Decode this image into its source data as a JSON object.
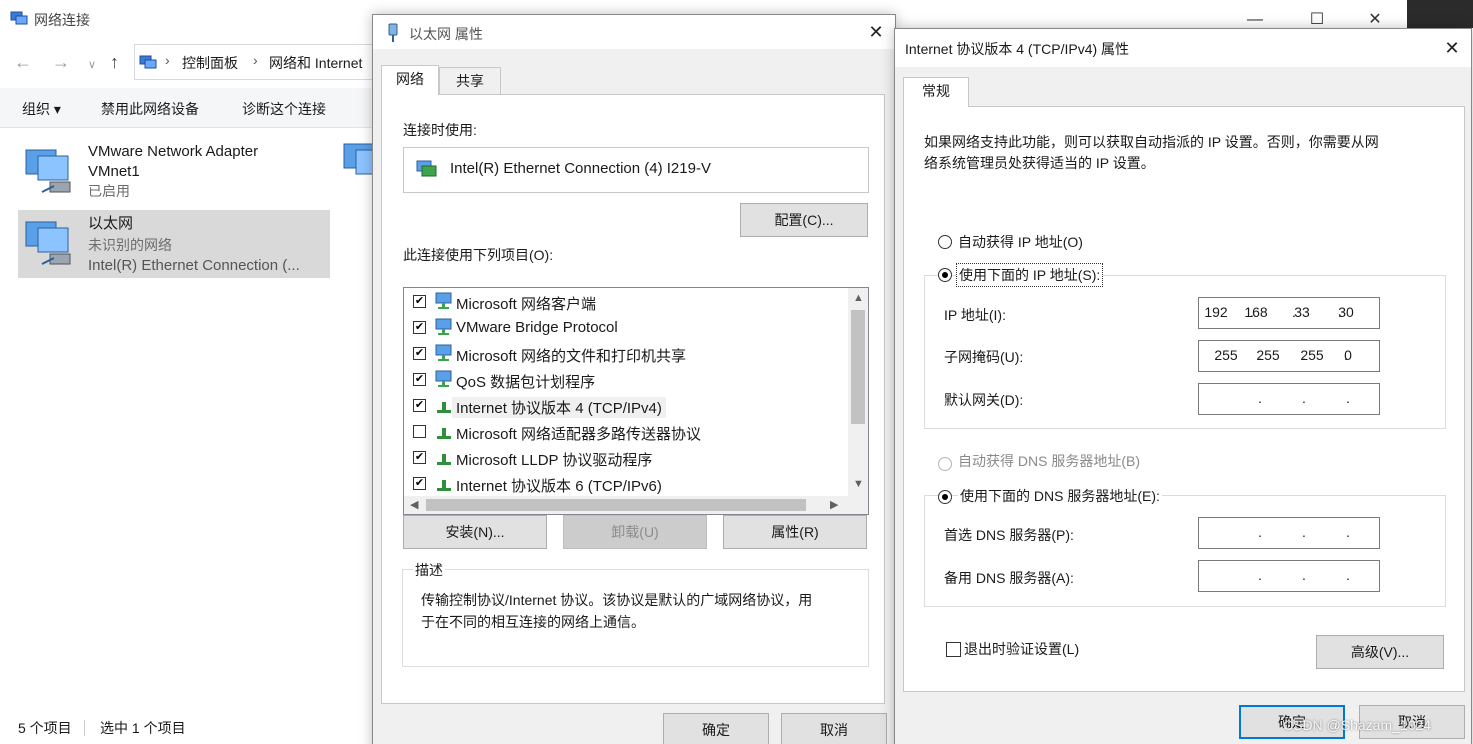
{
  "explorer": {
    "title": "网络连接",
    "breadcrumb": [
      "控制面板",
      "网络和 Internet"
    ],
    "commands": [
      "组织 ▾",
      "禁用此网络设备",
      "诊断这个连接"
    ],
    "connections": [
      {
        "name": "VMware Network Adapter",
        "name2": "VMnet1",
        "status": "已启用",
        "device": ""
      },
      {
        "name": "以太网",
        "name2": "",
        "status": "未识别的网络",
        "device": "Intel(R) Ethernet Connection (..."
      }
    ],
    "status": {
      "count": "5 个项目",
      "selected": "选中 1 个项目"
    }
  },
  "ethernet_dialog": {
    "title": "以太网 属性",
    "tabs": [
      "网络",
      "共享"
    ],
    "connect_using_label": "连接时使用:",
    "adapter": "Intel(R) Ethernet Connection (4) I219-V",
    "configure_label": "配置(C)...",
    "items_label": "此连接使用下列项目(O):",
    "items": [
      {
        "label": "Microsoft 网络客户端",
        "checked": true
      },
      {
        "label": "VMware Bridge Protocol",
        "checked": true
      },
      {
        "label": "Microsoft 网络的文件和打印机共享",
        "checked": true
      },
      {
        "label": "QoS 数据包计划程序",
        "checked": true
      },
      {
        "label": "Internet 协议版本 4 (TCP/IPv4)",
        "checked": true
      },
      {
        "label": "Microsoft 网络适配器多路传送器协议",
        "checked": false
      },
      {
        "label": "Microsoft LLDP 协议驱动程序",
        "checked": true
      },
      {
        "label": "Internet 协议版本 6 (TCP/IPv6)",
        "checked": true
      }
    ],
    "install_label": "安装(N)...",
    "uninstall_label": "卸载(U)",
    "properties_label": "属性(R)",
    "description_heading": "描述",
    "description_line1": "传输控制协议/Internet 协议。该协议是默认的广域网络协议，用",
    "description_line2": "于在不同的相互连接的网络上通信。",
    "ok_label": "确定",
    "cancel_label": "取消"
  },
  "ipv4_dialog": {
    "title": "Internet 协议版本 4 (TCP/IPv4) 属性",
    "tab": "常规",
    "intro_line1": "如果网络支持此功能，则可以获取自动指派的 IP 设置。否则，你需要从网",
    "intro_line2": "络系统管理员处获得适当的 IP 设置。",
    "auto_ip_label": "自动获得 IP 地址(O)",
    "manual_ip_label": "使用下面的 IP 地址(S):",
    "ip_label": "IP 地址(I):",
    "ip": [
      "192",
      "168",
      "33",
      "30"
    ],
    "mask_label": "子网掩码(U):",
    "mask": [
      "255",
      "255",
      "255",
      "0"
    ],
    "gateway_label": "默认网关(D):",
    "auto_dns_label": "自动获得 DNS 服务器地址(B)",
    "manual_dns_label": "使用下面的 DNS 服务器地址(E):",
    "preferred_dns_label": "首选 DNS 服务器(P):",
    "alternate_dns_label": "备用 DNS 服务器(A):",
    "validate_label": "退出时验证设置(L)",
    "advanced_label": "高级(V)...",
    "ok_label": "确定",
    "cancel_label": "取消",
    "watermark": "CSDN @Shazam_1024"
  },
  "colors": {
    "accent": "#0078d7",
    "selection": "#d9d9d9",
    "dialog_bg": "#f0f0f0"
  }
}
